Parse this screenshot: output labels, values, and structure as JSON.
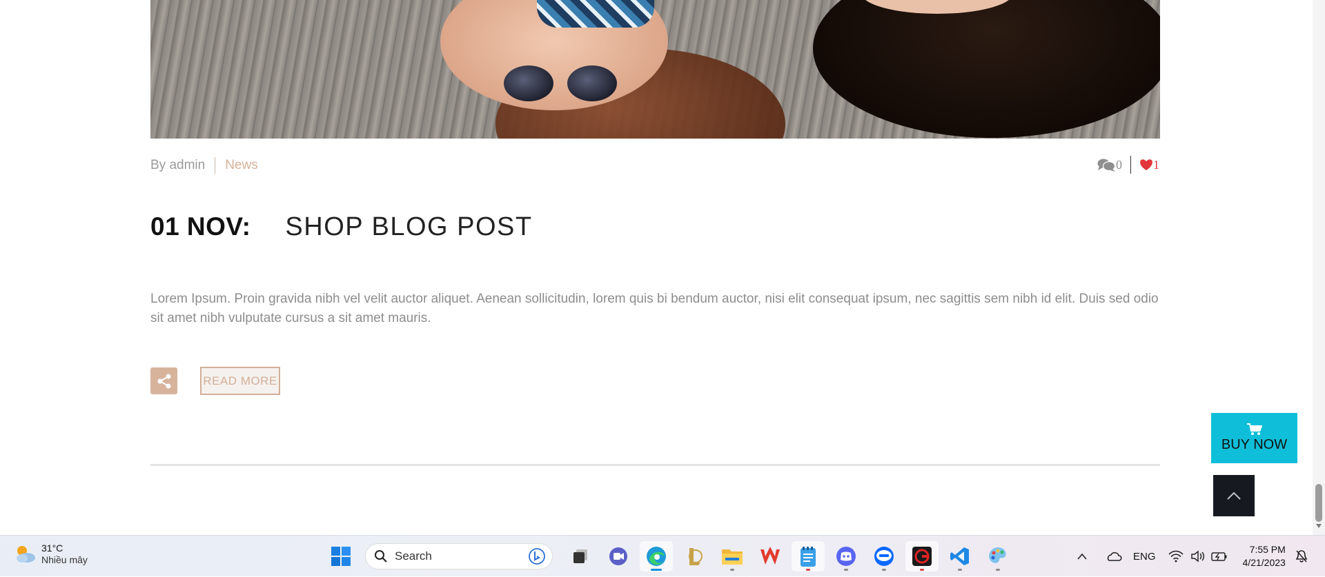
{
  "post": {
    "author_label": "By admin",
    "category": "News",
    "comment_count": "0",
    "like_count": "1",
    "date": "01 NOV:",
    "title": "SHOP BLOG POST",
    "excerpt": "Lorem Ipsum. Proin gravida nibh vel velit auctor aliquet. Aenean sollicitudin, lorem quis bi bendum auctor, nisi elit consequat ipsum, nec sagittis sem nibh id elit. Duis sed odio sit amet nibh vulputate cursus a sit amet mauris.",
    "read_more_label": "READ MORE",
    "share_icon": "share-icon"
  },
  "floating": {
    "buy_now_label": "BUY NOW",
    "buy_now_color": "#0fbfd9",
    "back_to_top_icon": "chevron-up-icon"
  },
  "colors": {
    "accent": "#d3ae96",
    "like": "#e2363b"
  },
  "taskbar": {
    "weather": {
      "temp": "31°C",
      "condition": "Nhiều mây"
    },
    "search_placeholder": "Search",
    "apps": [
      "start",
      "search",
      "task-view",
      "meet",
      "edge",
      "league-of-legends",
      "file-explorer",
      "wps-office",
      "notepad",
      "discord",
      "zalo",
      "garena",
      "vscode",
      "paint"
    ],
    "tray": {
      "language": "ENG",
      "time": "7:55 PM",
      "date": "4/21/2023"
    }
  }
}
